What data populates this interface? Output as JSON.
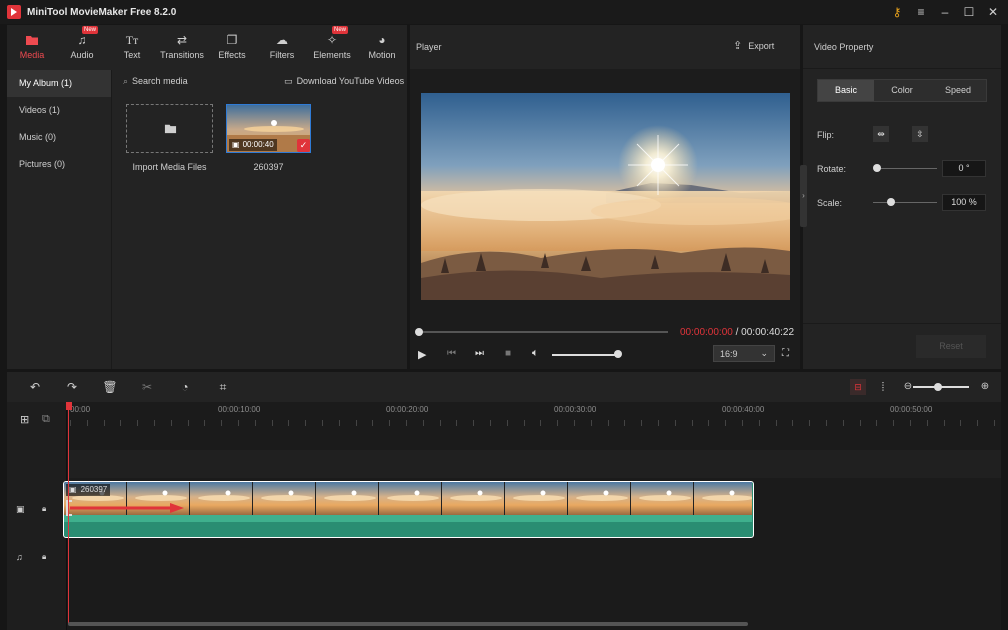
{
  "app": {
    "title": "MiniTool MovieMaker Free 8.2.0"
  },
  "toolbar": {
    "items": [
      {
        "label": "Media",
        "icon": "folder-icon",
        "active": true,
        "new": false
      },
      {
        "label": "Audio",
        "icon": "music-icon",
        "active": false,
        "new": true
      },
      {
        "label": "Text",
        "icon": "text-icon",
        "active": false,
        "new": false
      },
      {
        "label": "Transitions",
        "icon": "transitions-icon",
        "active": false,
        "new": false
      },
      {
        "label": "Effects",
        "icon": "effects-icon",
        "active": false,
        "new": false
      },
      {
        "label": "Filters",
        "icon": "filters-icon",
        "active": false,
        "new": false
      },
      {
        "label": "Elements",
        "icon": "elements-icon",
        "active": false,
        "new": true
      },
      {
        "label": "Motion",
        "icon": "motion-icon",
        "active": false,
        "new": false
      }
    ],
    "new_badge": "New"
  },
  "albums": [
    {
      "label": "My Album  (1)",
      "active": true
    },
    {
      "label": "Videos  (1)",
      "active": false
    },
    {
      "label": "Music  (0)",
      "active": false
    },
    {
      "label": "Pictures  (0)",
      "active": false
    }
  ],
  "media": {
    "search_placeholder": "Search media",
    "download_label": "Download YouTube Videos",
    "import_label": "Import Media Files",
    "clip_name": "260397",
    "clip_duration": "00:00:40"
  },
  "player": {
    "title": "Player",
    "export_label": "Export",
    "time_current": "00:00:00:00",
    "time_separator": " / ",
    "time_total": "00:00:40:22",
    "aspect": "16:9",
    "progress": 0.0,
    "volume": 1.0
  },
  "property": {
    "title": "Video Property",
    "tabs": [
      {
        "label": "Basic",
        "active": true
      },
      {
        "label": "Color",
        "active": false
      },
      {
        "label": "Speed",
        "active": false
      }
    ],
    "flip_label": "Flip:",
    "rotate_label": "Rotate:",
    "rotate_value": "0 °",
    "scale_label": "Scale:",
    "scale_value": "100 %",
    "reset_label": "Reset"
  },
  "timeline": {
    "ruler": [
      "00:00",
      "00:00:10:00",
      "00:00:20:00",
      "00:00:30:00",
      "00:00:40:00",
      "00:00:50:00"
    ],
    "clip_name": "260397"
  },
  "colors": {
    "accent": "#e0343a",
    "clip_green": "#2a8d72",
    "selection": "#2f7bd6"
  }
}
